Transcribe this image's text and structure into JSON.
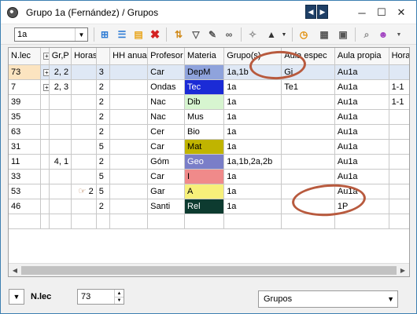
{
  "window": {
    "title": "Grupo 1a (Fernández) / Grupos"
  },
  "toolbar": {
    "class_value": "1a"
  },
  "grid": {
    "columns": [
      "N.lec",
      "",
      "Gr,P",
      "Horas",
      "",
      "HH anua",
      "Profesor",
      "Materia",
      "Grupo(s)",
      "Aula espec",
      "Aula propia",
      "Horas dobl."
    ],
    "rows": [
      {
        "nlec": "73",
        "grp": "2, 2",
        "icon": "",
        "horas": "3",
        "prof": "Car",
        "mat": "DepM",
        "mat_color": "#8fa3dc",
        "mat_text": "#000000",
        "grupos": "1a,1b",
        "aula_esp": "Gi",
        "aula_prop": "Au1a",
        "dobl": "",
        "selected": true,
        "plus": true
      },
      {
        "nlec": "7",
        "grp": "2, 3",
        "icon": "",
        "horas": "2",
        "prof": "Ondas",
        "mat": "Tec",
        "mat_color": "#1b2bd6",
        "mat_text": "#ffffff",
        "grupos": "1a",
        "aula_esp": "Te1",
        "aula_prop": "Au1a",
        "dobl": "1-1",
        "selected": false,
        "plus": true
      },
      {
        "nlec": "39",
        "grp": "",
        "icon": "",
        "horas": "2",
        "prof": "Nac",
        "mat": "Dib",
        "mat_color": "#d7f5d0",
        "mat_text": "#000000",
        "grupos": "1a",
        "aula_esp": "",
        "aula_prop": "Au1a",
        "dobl": "1-1",
        "selected": false,
        "plus": false
      },
      {
        "nlec": "35",
        "grp": "",
        "icon": "",
        "horas": "2",
        "prof": "Nac",
        "mat": "Mus",
        "mat_color": "#ffffff",
        "mat_text": "#000000",
        "grupos": "1a",
        "aula_esp": "",
        "aula_prop": "Au1a",
        "dobl": "",
        "selected": false,
        "plus": false
      },
      {
        "nlec": "63",
        "grp": "",
        "icon": "",
        "horas": "2",
        "prof": "Cer",
        "mat": "Bio",
        "mat_color": "#ffffff",
        "mat_text": "#000000",
        "grupos": "1a",
        "aula_esp": "",
        "aula_prop": "Au1a",
        "dobl": "",
        "selected": false,
        "plus": false
      },
      {
        "nlec": "31",
        "grp": "",
        "icon": "",
        "horas": "5",
        "prof": "Car",
        "mat": "Mat",
        "mat_color": "#c0b400",
        "mat_text": "#000000",
        "grupos": "1a",
        "aula_esp": "",
        "aula_prop": "Au1a",
        "dobl": "",
        "selected": false,
        "plus": false
      },
      {
        "nlec": "11",
        "grp": "4, 1",
        "icon": "",
        "horas": "2",
        "prof": "Góm",
        "mat": "Geo",
        "mat_color": "#7a7ec8",
        "mat_text": "#ffffff",
        "grupos": "1a,1b,2a,2b",
        "aula_esp": "",
        "aula_prop": "Au1a",
        "dobl": "",
        "selected": false,
        "plus": false
      },
      {
        "nlec": "33",
        "grp": "",
        "icon": "",
        "horas": "5",
        "prof": "Car",
        "mat": "I",
        "mat_color": "#f08a8a",
        "mat_text": "#000000",
        "grupos": "1a",
        "aula_esp": "",
        "aula_prop": "Au1a",
        "dobl": "",
        "selected": false,
        "plus": false
      },
      {
        "nlec": "53",
        "grp": "",
        "icon": "2",
        "horas": "5",
        "prof": "Gar",
        "mat": "A",
        "mat_color": "#f7f07a",
        "mat_text": "#000000",
        "grupos": "1a",
        "aula_esp": "",
        "aula_prop": "Au1a",
        "dobl": "",
        "selected": false,
        "plus": false
      },
      {
        "nlec": "46",
        "grp": "",
        "icon": "",
        "horas": "2",
        "prof": "Santi",
        "mat": "Rel",
        "mat_color": "#0d3b30",
        "mat_text": "#ffffff",
        "grupos": "1a",
        "aula_esp": "",
        "aula_prop": "1P",
        "dobl": "",
        "selected": false,
        "plus": false
      }
    ]
  },
  "status": {
    "field_label": "N.lec",
    "field_value": "73",
    "view_select": "Grupos"
  },
  "colors": {
    "accent_ellipse": "#b85a3e",
    "selection": "#dfe8f5"
  }
}
